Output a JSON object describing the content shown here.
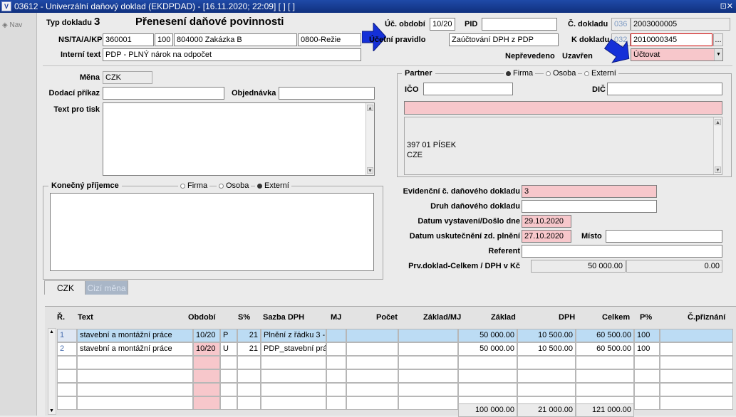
{
  "window": {
    "title": "03612 - Univerzální daňový doklad (EKDPDAD) - [16.11.2020; 22:09]  [ ]  [ ]",
    "app_icon": "V",
    "controls": "⊡✕"
  },
  "nav": {
    "label": "Nav"
  },
  "header": {
    "typ_dokladu_label": "Typ dokladu",
    "typ_dokladu_value": "3",
    "typ_dokladu_name": "Přenesení daňové povinnosti",
    "uc_obdobi_label": "Úč. období",
    "uc_obdobi_value": "10/20",
    "pid_label": "PID",
    "pid_value": "",
    "c_dokladu_label": "Č. dokladu",
    "c_dokladu_prefix": "036",
    "c_dokladu_value": "2003000005",
    "ns_label": "NS/TA/A/KP",
    "ns_value": "360001",
    "ta_value": "100",
    "a_value": "804000 Zakázka B",
    "kp_value": "0800-Režie",
    "ucetni_pravidlo_label": "Účetní pravidlo",
    "ucetni_pravidlo_value": "Zaúčtování DPH z PDP",
    "k_dokladu_label": "K dokladu",
    "k_dokladu_prefix": "032",
    "k_dokladu_value": "2010000345",
    "k_dokladu_btn": "...",
    "interni_text_label": "Interní text",
    "interni_text_value": "PDP - PLNÝ nárok na odpočet",
    "neprevedeno_label": "Nepřevedeno",
    "uzavren_label": "Uzavřen",
    "uzavren_value": "Účtovat"
  },
  "left": {
    "mena_label": "Měna",
    "mena_value": "CZK",
    "dodaci_prikaz_label": "Dodací příkaz",
    "dodaci_prikaz_value": "",
    "objednavka_label": "Objednávka",
    "objednavka_value": "",
    "text_pro_tisk_label": "Text pro tisk",
    "text_pro_tisk_value": "",
    "konecny_prijemce_label": "Konečný příjemce",
    "kp_radio_firma": "Firma",
    "kp_radio_osoba": "Osoba",
    "kp_radio_externi": "Externí"
  },
  "partner": {
    "label": "Partner",
    "radio_firma": "Firma",
    "radio_osoba": "Osoba",
    "radio_externi": "Externí",
    "ico_label": "IČO",
    "ico_value": "",
    "dic_label": "DIČ",
    "dic_value": "",
    "name_value": "",
    "address_line1": "397 01 PÍSEK",
    "address_line2": "CZE"
  },
  "right": {
    "evid_label": "Evidenční č. daňového dokladu",
    "evid_value": "3",
    "druh_label": "Druh daňového dokladu",
    "druh_value": "",
    "datum_vyst_label": "Datum vystavení/Došlo dne",
    "datum_vyst_value": "29.10.2020",
    "datum_usk_label": "Datum uskutečnění zd. plnění",
    "datum_usk_value": "27.10.2020",
    "misto_label": "Místo",
    "misto_value": "",
    "referent_label": "Referent",
    "referent_value": "",
    "prv_label": "Prv.doklad-Celkem / DPH v Kč",
    "prv_celkem": "50 000.00",
    "prv_dph": "0.00"
  },
  "tabs": [
    {
      "label": "CZK"
    },
    {
      "label": "Cizí měna"
    }
  ],
  "grid": {
    "headers": {
      "r": "Ř.",
      "text": "Text",
      "obdobi": "Období",
      "s_pct": "S%",
      "sazba": "Sazba DPH",
      "mj": "MJ",
      "pocet": "Počet",
      "zaklad_mj": "Základ/MJ",
      "zaklad": "Základ",
      "dph": "DPH",
      "celkem": "Celkem",
      "p_pct": "P%",
      "c_priznani": "Č.přiznání"
    },
    "rows": [
      {
        "r": "1",
        "text": "stavební a montážní práce",
        "obdobi": "10/20",
        "s": "P",
        "pct": "21",
        "sazba": "Plnění z řádku 3 -",
        "mj": "",
        "pocet": "",
        "zaklad_mj": "",
        "zaklad": "50 000.00",
        "dph": "10 500.00",
        "celkem": "60 500.00",
        "p": "100",
        "c_priznani": ""
      },
      {
        "r": "2",
        "text": "stavební a montážní práce",
        "obdobi": "10/20",
        "s": "U",
        "pct": "21",
        "sazba": "PDP_stavební prá",
        "mj": "",
        "pocet": "",
        "zaklad_mj": "",
        "zaklad": "50 000.00",
        "dph": "10 500.00",
        "celkem": "60 500.00",
        "p": "100",
        "c_priznani": ""
      }
    ],
    "totals": {
      "zaklad": "100 000.00",
      "dph": "21 000.00",
      "celkem": "121 000.00"
    }
  },
  "colors": {
    "title_bar": "#1f4aa8",
    "pink_required": "#f7c7cb",
    "row_selected": "#bcdcf4",
    "arrow": "#1530d8"
  }
}
